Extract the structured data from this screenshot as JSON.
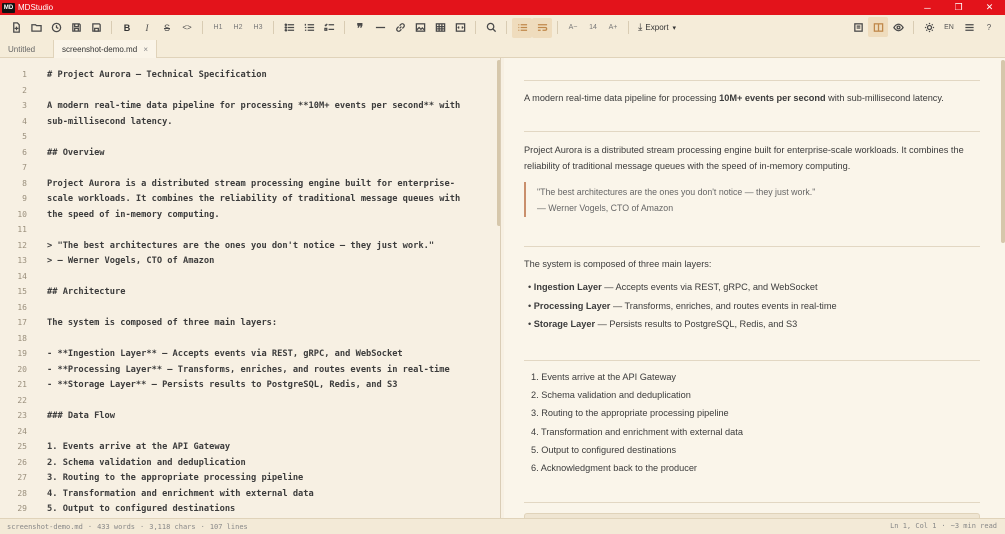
{
  "app": {
    "title": "MDStudio",
    "logo_text": "MD",
    "window_controls": [
      "─",
      "❐",
      "✕"
    ]
  },
  "toolbar": {
    "heading_buttons": [
      "H1",
      "H2",
      "H3"
    ],
    "bold_label": "B",
    "italic_label": "I",
    "strike_label": "S",
    "code_label": "<>",
    "font_decrease": "A−",
    "font_size": "14",
    "font_increase": "A+",
    "export_label": "Export",
    "language": "EN",
    "help": "?"
  },
  "tabs": [
    {
      "label": "Untitled"
    },
    {
      "label": "screenshot-demo.md",
      "close": "×"
    }
  ],
  "editor": {
    "lines": [
      {
        "n": "1",
        "text": "# Project Aurora — Technical Specification"
      },
      {
        "n": "2",
        "text": ""
      },
      {
        "n": "3",
        "text": "A modern real-time data pipeline for processing **10M+ events per second** with"
      },
      {
        "n": "4",
        "text": "sub-millisecond latency."
      },
      {
        "n": "5",
        "text": ""
      },
      {
        "n": "6",
        "text": "## Overview"
      },
      {
        "n": "7",
        "text": ""
      },
      {
        "n": "8",
        "text": "Project Aurora is a distributed stream processing engine built for enterprise-"
      },
      {
        "n": "9",
        "text": "scale workloads. It combines the reliability of traditional message queues with"
      },
      {
        "n": "10",
        "text": "the speed of in-memory computing."
      },
      {
        "n": "11",
        "text": ""
      },
      {
        "n": "12",
        "text": "> \"The best architectures are the ones you don't notice — they just work.\""
      },
      {
        "n": "13",
        "text": "> — Werner Vogels, CTO of Amazon"
      },
      {
        "n": "14",
        "text": ""
      },
      {
        "n": "15",
        "text": "## Architecture"
      },
      {
        "n": "16",
        "text": ""
      },
      {
        "n": "17",
        "text": "The system is composed of three main layers:"
      },
      {
        "n": "18",
        "text": ""
      },
      {
        "n": "19",
        "text": "- **Ingestion Layer** — Accepts events via REST, gRPC, and WebSocket"
      },
      {
        "n": "20",
        "text": "- **Processing Layer** — Transforms, enriches, and routes events in real-time"
      },
      {
        "n": "21",
        "text": "- **Storage Layer** — Persists results to PostgreSQL, Redis, and S3"
      },
      {
        "n": "22",
        "text": ""
      },
      {
        "n": "23",
        "text": "### Data Flow"
      },
      {
        "n": "24",
        "text": ""
      },
      {
        "n": "25",
        "text": "1. Events arrive at the API Gateway"
      },
      {
        "n": "26",
        "text": "2. Schema validation and deduplication"
      },
      {
        "n": "27",
        "text": "3. Routing to the appropriate processing pipeline"
      },
      {
        "n": "28",
        "text": "4. Transformation and enrichment with external data"
      },
      {
        "n": "29",
        "text": "5. Output to configured destinations"
      }
    ]
  },
  "preview": {
    "intro_pre": "A modern real-time data pipeline for processing ",
    "intro_bold": "10M+ events per second",
    "intro_post": " with sub-millisecond latency.",
    "overview_line1": "Project Aurora is a distributed stream processing engine built for enterprise-scale workloads. It combines the",
    "overview_line2": "reliability of traditional message queues with the speed of in-memory computing.",
    "quote_text": "\"The best architectures are the ones you don't notice — they just work.\"",
    "quote_author": "— Werner Vogels, CTO of Amazon",
    "arch_intro": "The system is composed of three main layers:",
    "layers": [
      {
        "name": "Ingestion Layer",
        "desc": " — Accepts events via REST, gRPC, and WebSocket"
      },
      {
        "name": "Processing Layer",
        "desc": " — Transforms, enriches, and routes events in real-time"
      },
      {
        "name": "Storage Layer",
        "desc": " — Persists results to PostgreSQL, Redis, and S3"
      }
    ],
    "steps": [
      "1. Events arrive at the API Gateway",
      "2. Schema validation and deduplication",
      "3. Routing to the appropriate processing pipeline",
      "4. Transformation and enrichment with external data",
      "5. Output to configured destinations",
      "6. Acknowledgment back to the producer"
    ]
  },
  "status": {
    "filename": "screenshot-demo.md",
    "words": "433 words",
    "chars": "3,118 chars",
    "lines": "107 lines",
    "cursor": "Ln 1, Col 1",
    "read_time": "~3 min read"
  }
}
